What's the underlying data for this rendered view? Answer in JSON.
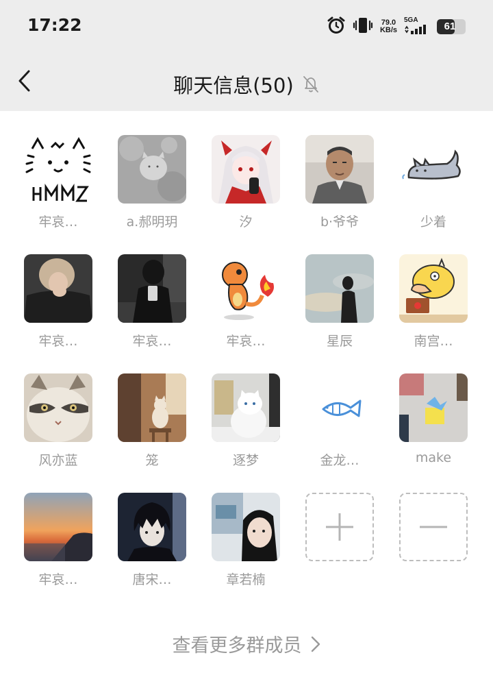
{
  "status_bar": {
    "time": "17:22",
    "net_speed_value": "79.0",
    "net_speed_unit": "KB/s",
    "network_type": "5GA",
    "battery_level": "61",
    "battery_fraction": 0.61,
    "icons": [
      "alarm-icon",
      "vibrate-icon",
      "signal-icon",
      "battery-icon"
    ]
  },
  "header": {
    "title": "聊天信息(50)",
    "back_icon": "chevron-left-icon",
    "mute_icon": "bell-muted-icon"
  },
  "members": [
    {
      "name": "牢哀…",
      "avatar": "cat-doodle-hmz"
    },
    {
      "name": "a.郝明玥",
      "avatar": "gray-snow-cat"
    },
    {
      "name": "汐",
      "avatar": "anime-white-hair-girl"
    },
    {
      "name": "b·爷爷",
      "avatar": "old-man-photo"
    },
    {
      "name": "少着",
      "avatar": "lying-gray-cat-sticker"
    },
    {
      "name": "牢哀…",
      "avatar": "person-black-hoodie"
    },
    {
      "name": "牢哀…",
      "avatar": "mirror-selfie-dark"
    },
    {
      "name": "牢哀…",
      "avatar": "charmander-sticker"
    },
    {
      "name": "星辰",
      "avatar": "silhouette-sky"
    },
    {
      "name": "南宫…",
      "avatar": "psyduck-laptop"
    },
    {
      "name": "风亦蓝",
      "avatar": "raccoon-cat-meme"
    },
    {
      "name": "笼",
      "avatar": "cat-on-stool"
    },
    {
      "name": "逐梦",
      "avatar": "white-fluffy-cat"
    },
    {
      "name": "金龙…",
      "avatar": "blue-fish-doodle"
    },
    {
      "name": "make",
      "avatar": "origami-desk"
    },
    {
      "name": "牢哀…",
      "avatar": "sunset-mountain"
    },
    {
      "name": "唐宋…",
      "avatar": "anime-dark-hair-boy"
    },
    {
      "name": "章若楠",
      "avatar": "girl-selfie"
    }
  ],
  "actions": {
    "add_member_icon": "plus-icon",
    "remove_member_icon": "minus-icon"
  },
  "footer": {
    "more_members_label": "查看更多群成员",
    "more_icon": "chevron-right-icon"
  }
}
